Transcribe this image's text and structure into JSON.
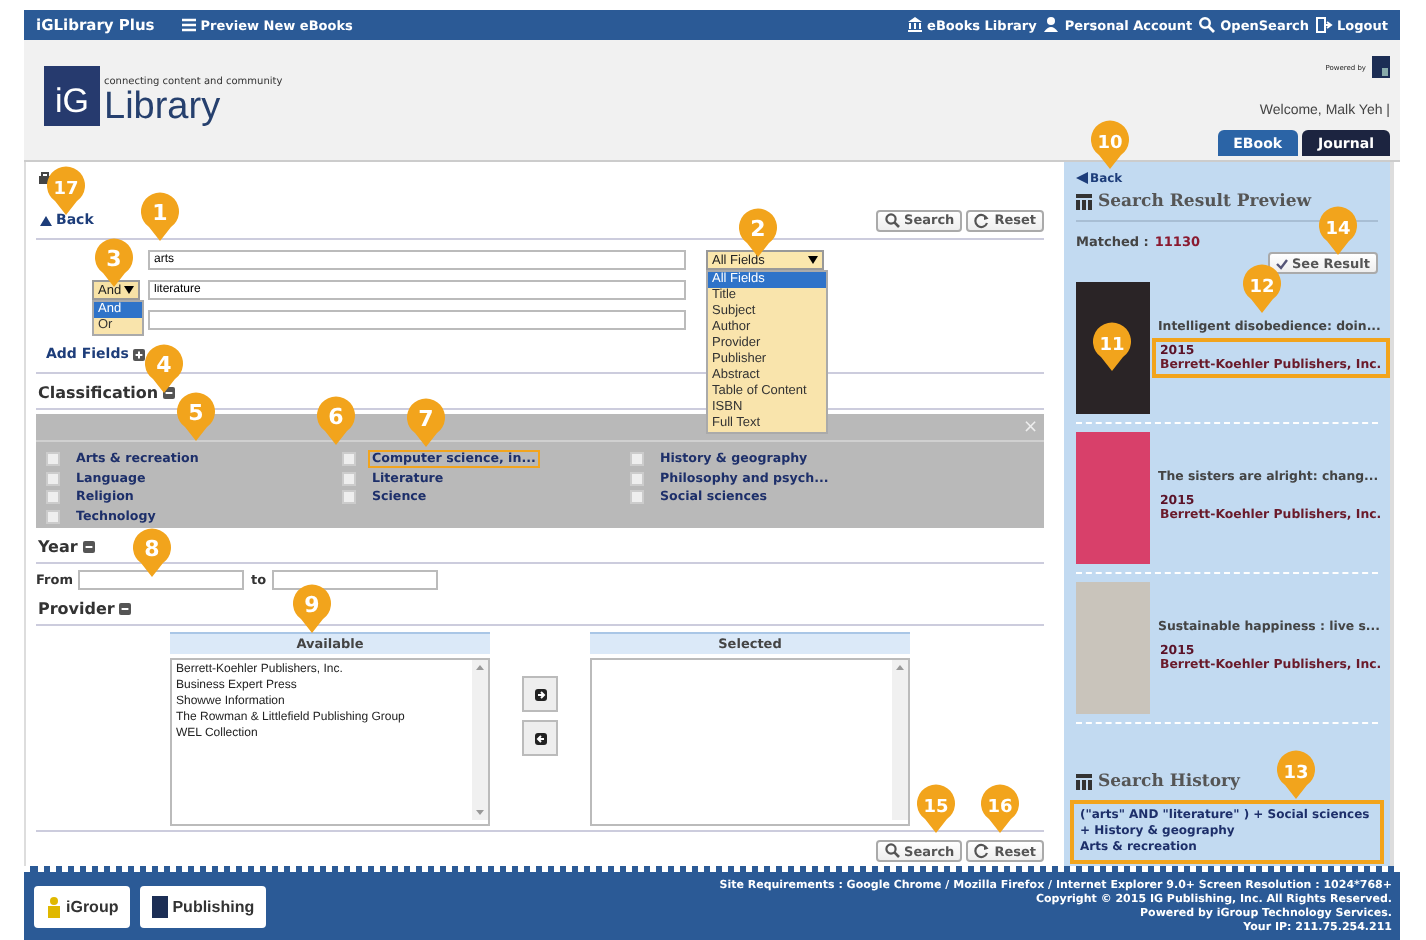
{
  "top_bar": {
    "brand": "iGLibrary Plus",
    "preview_link": "Preview New eBooks",
    "links": [
      {
        "kind": "library",
        "label": "eBooks Library"
      },
      {
        "kind": "account",
        "label": "Personal Account"
      },
      {
        "kind": "search",
        "label": "OpenSearch"
      },
      {
        "kind": "logout",
        "label": "Logout"
      }
    ]
  },
  "header": {
    "logo_tagline": "connecting content and community",
    "logo_mark": "iG",
    "logo_word": "Library",
    "powered_by": "Powered by",
    "welcome": "Welcome, Malk Yeh |",
    "tabs": [
      {
        "label": "EBook",
        "selected": true
      },
      {
        "label": "Journal",
        "selected": false
      }
    ]
  },
  "search_form": {
    "back": "Back",
    "top_buttons": [
      {
        "kind": "search",
        "label": "Search"
      },
      {
        "kind": "reset",
        "label": "Reset"
      }
    ],
    "rows": [
      {
        "value": "arts"
      },
      {
        "operator": "And",
        "value": "literature"
      },
      {}
    ],
    "field_select": {
      "value": "All Fields",
      "options": [
        {
          "label": "All Fields",
          "selected": true
        },
        {
          "label": "Title",
          "selected": false
        },
        {
          "label": "Subject",
          "selected": false
        },
        {
          "label": "Author",
          "selected": false
        },
        {
          "label": "Provider",
          "selected": false
        },
        {
          "label": "Publisher",
          "selected": false
        },
        {
          "label": "Abstract",
          "selected": false
        },
        {
          "label": "Table of Content",
          "selected": false
        },
        {
          "label": "ISBN",
          "selected": false
        },
        {
          "label": "Full Text",
          "selected": false
        }
      ]
    },
    "operator_options": [
      {
        "label": "And",
        "selected": true
      },
      {
        "label": "Or",
        "selected": false
      }
    ],
    "add_fields": "Add Fields",
    "classification": {
      "title": "Classification",
      "close": "×",
      "items": [
        {
          "label": "Arts & recreation",
          "checked": false,
          "highlighted": false
        },
        {
          "label": "Computer science, in...",
          "checked": false,
          "highlighted": true
        },
        {
          "label": "History & geography",
          "checked": false,
          "highlighted": false
        },
        {
          "label": "Language",
          "checked": false,
          "highlighted": false
        },
        {
          "label": "Literature",
          "checked": false,
          "highlighted": false
        },
        {
          "label": "Philosophy and psych...",
          "checked": false,
          "highlighted": false
        },
        {
          "label": "Religion",
          "checked": false,
          "highlighted": false
        },
        {
          "label": "Science",
          "checked": false,
          "highlighted": false
        },
        {
          "label": "Social sciences",
          "checked": false,
          "highlighted": false
        },
        {
          "label": "Technology",
          "checked": false,
          "highlighted": false
        }
      ]
    },
    "year": {
      "title": "Year",
      "from_label": "From",
      "to_label": "to"
    },
    "provider": {
      "title": "Provider",
      "available_title": "Available",
      "selected_title": "Selected",
      "available": [
        "Berrett-Koehler Publishers, Inc.",
        "Business Expert Press",
        "Showwe Information",
        "The Rowman & Littlefield Publishing Group",
        "WEL Collection"
      ]
    },
    "bottom_buttons": [
      {
        "kind": "search",
        "label": "Search"
      },
      {
        "kind": "reset",
        "label": "Reset"
      }
    ]
  },
  "preview": {
    "back": "Back",
    "title": "Search Result Preview",
    "matched_label": "Matched :",
    "matched_count": "11130",
    "see_result": "See Result",
    "results": [
      {
        "title": "Intelligent disobedience: doin...",
        "year": "2015",
        "publisher": "Berrett-Koehler Publishers, Inc.",
        "highlighted": true
      },
      {
        "title": "The sisters are alright: chang...",
        "year": "2015",
        "publisher": "Berrett-Koehler Publishers, Inc.",
        "highlighted": false
      },
      {
        "title": "Sustainable happiness : live s...",
        "year": "2015",
        "publisher": "Berrett-Koehler Publishers, Inc.",
        "highlighted": false
      }
    ],
    "history_title": "Search History",
    "history": [
      "(\"arts\" AND \"literature\" ) + Social sciences + History & geography",
      "Arts & recreation"
    ],
    "history_highlighted": true
  },
  "footer": {
    "logos": [
      "iGroup",
      "Publishing"
    ],
    "lines": [
      "Site Requirements : Google Chrome / Mozilla Firefox / Internet Explorer 9.0+ Screen Resolution : 1024*768+",
      "Copyright © 2015 IG Publishing, Inc. All Rights Reserved.",
      "Powered by iGroup Technology Services.",
      "Your IP: 211.75.254.211"
    ]
  },
  "callouts": [
    "1",
    "2",
    "3",
    "4",
    "5",
    "6",
    "7",
    "8",
    "9",
    "10",
    "11",
    "12",
    "13",
    "14",
    "15",
    "16",
    "17"
  ]
}
